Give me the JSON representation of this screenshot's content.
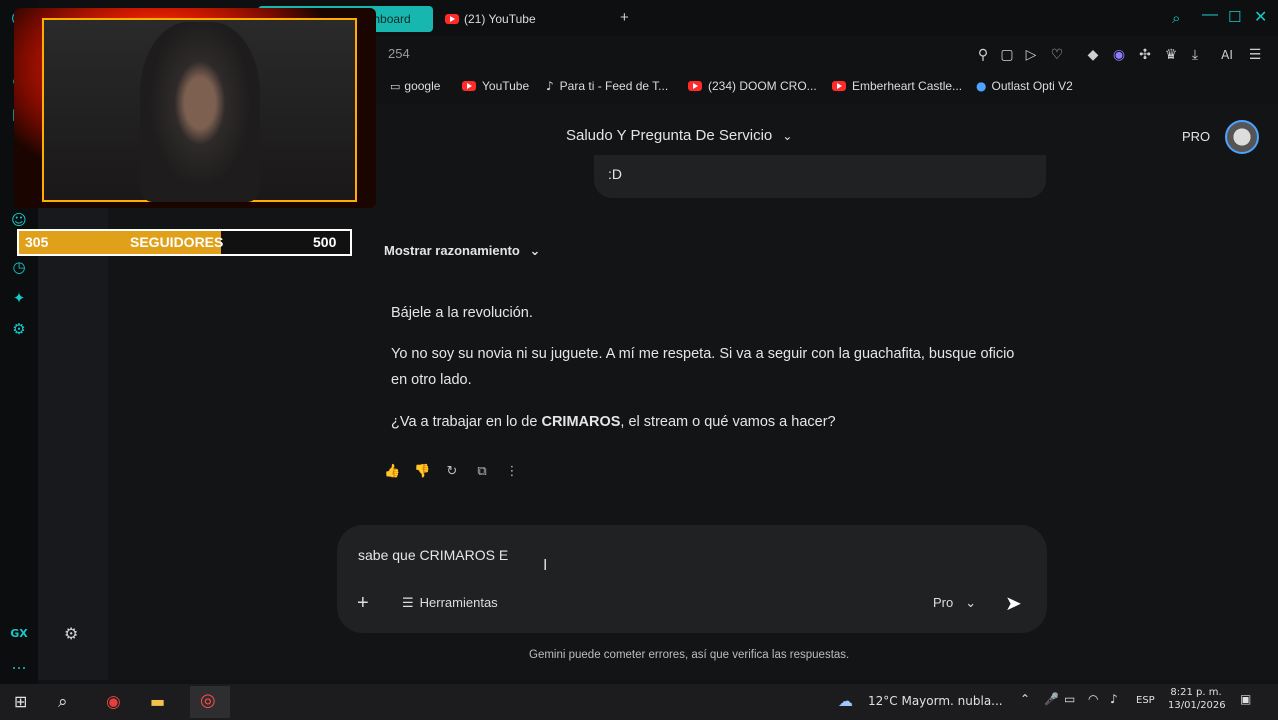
{
  "tabs": {
    "active_label": "Stream Kick Dashboard",
    "youtube_label": "(21) YouTube",
    "new_tab_icon": "plus-icon"
  },
  "address": {
    "fragment": "254"
  },
  "bookmarks": [
    {
      "label": "google",
      "icon": "folder-icon"
    },
    {
      "label": "YouTube",
      "icon": "youtube-icon"
    },
    {
      "label": "Para ti - Feed de T...",
      "icon": "tiktok-icon"
    },
    {
      "label": "(234) DOOM CRO...",
      "icon": "youtube-icon"
    },
    {
      "label": "Emberheart Castle...",
      "icon": "youtube-icon"
    },
    {
      "label": "Outlast Opti V2",
      "icon": "globe-icon"
    }
  ],
  "toolbar": {
    "ai_label": "AI"
  },
  "header": {
    "topic": "Saludo Y Pregunta De Servicio",
    "pro_label": "PRO"
  },
  "chat": {
    "user_bubble": ":D",
    "reasoning_toggle": "Mostrar razonamiento",
    "p1": "Bájele a la revolución.",
    "p2": "Yo no soy su novia ni su juguete. A mí me respeta. Si va a seguir con la guachafita, busque oficio en otro lado.",
    "p3_pre": "¿Va a trabajar en lo de ",
    "p3_bold": "CRIMAROS",
    "p3_post": ", el stream o qué vamos a hacer?"
  },
  "composer": {
    "value": "sabe que CRIMAROS E",
    "tools_label": "Herramientas",
    "model_label": "Pro"
  },
  "footer_note": "Gemini puede cometer errores, así que verifica las respuestas.",
  "overlay": {
    "current": "305",
    "label": "SEGUIDORES",
    "goal": "500",
    "progress_fraction": 0.61
  },
  "rail": {
    "gx_label": "GX"
  },
  "taskbar": {
    "weather": "12°C  Mayorm. nubla...",
    "lang": "ESP",
    "time": "8:21 p. m.",
    "date": "13/01/2026"
  },
  "colors": {
    "accent": "#19c8c8",
    "youtube": "#ff2a2a",
    "bar_fill": "#e0a01a"
  }
}
